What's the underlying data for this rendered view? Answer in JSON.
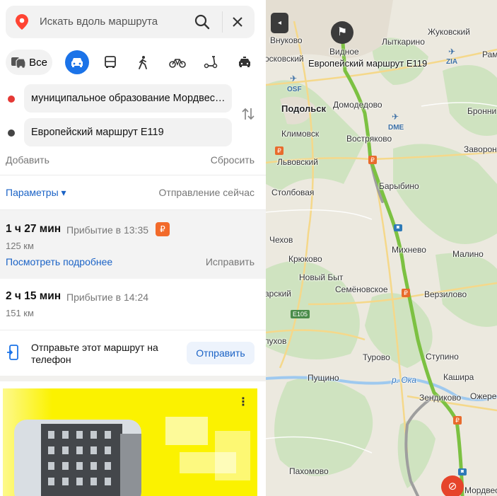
{
  "search": {
    "placeholder": "Искать вдоль маршрута"
  },
  "modes": {
    "all_label": "Все",
    "active": "car"
  },
  "route_points": {
    "from": "муниципальное образование Мордвес…",
    "to": "Европейский маршрут E119"
  },
  "actions": {
    "add": "Добавить",
    "reset": "Сбросить"
  },
  "params": {
    "label": "Параметры ▾",
    "departure": "Отправление сейчас"
  },
  "routes": [
    {
      "time": "1 ч 27 мин",
      "arrival": "Прибытие в 13:35",
      "distance": "125 км",
      "toll_icon": "₽",
      "more": "Посмотреть подробнее",
      "fix": "Исправить"
    },
    {
      "time": "2 ч 15 мин",
      "arrival": "Прибытие в 14:24",
      "distance": "151 км"
    }
  ],
  "send": {
    "text": "Отправьте этот маршрут на телефон",
    "button": "Отправить"
  },
  "ad": {
    "menu": "⋮"
  },
  "map": {
    "collapse": "◂",
    "start_icon": "⚑",
    "end_icon": "⊘",
    "dest_label": "Европейский маршрут E119",
    "highway_shield": "E105",
    "toll_marker": "₽",
    "rail_marker": "◙",
    "places": {
      "moskovsky": "осковский",
      "vnukovo": "Внуково",
      "vidnoe": "Видное",
      "zhukovsky": "Жуковский",
      "lytkarino": "Лыткарино",
      "ram": "Рам",
      "zia": "ZIA",
      "osf": "OSF",
      "podolsk": "Подольск",
      "domodedovo": "Домодедово",
      "bronni": "Бронни",
      "klimovsk": "Климовск",
      "dme": "DME",
      "vostryakovo": "Востряково",
      "zavoronki": "Заворонк",
      "lvovsky": "Львовский",
      "barybino": "Барыбино",
      "stolbovaya": "Столбовая",
      "chekhov": "Чехов",
      "mikhnevo": "Михнево",
      "malino": "Малино",
      "kryukovo": "Крюково",
      "novy_byt": "Новый Быт",
      "verzilovo": "Верзилово",
      "arsky": "арский",
      "semenovskoe": "Семёновское",
      "pukhov": "пухов",
      "turovo": "Турово",
      "stupino": "Ступино",
      "pushchino": "Пущино",
      "oka": "р. Ока",
      "kashira": "Кашира",
      "ozhere": "Ожере",
      "zendikovo": "Зендиково",
      "pakhomovo": "Пахомово",
      "mordves": "Мордвес"
    }
  },
  "colors": {
    "accent": "#1b73e8",
    "route": "#7cc142",
    "alt_route": "#9e9e9e",
    "start_dot": "#e53935",
    "end_dot": "#444444",
    "toll": "#f26a2a"
  }
}
